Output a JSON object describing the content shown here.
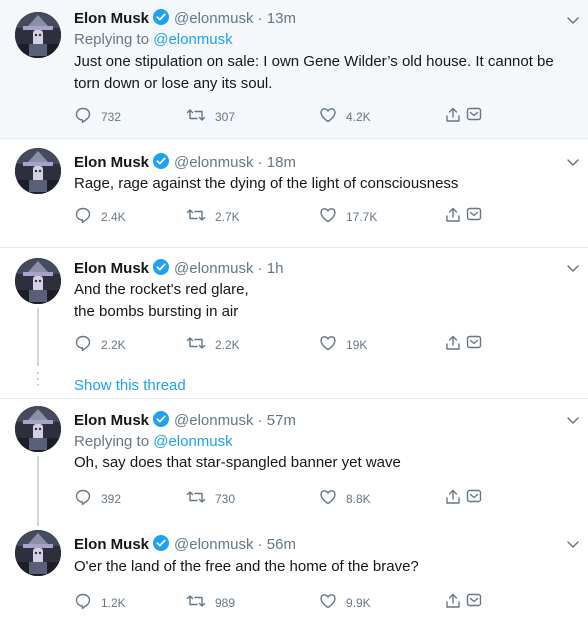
{
  "tweets": [
    {
      "name": "Elon Musk",
      "handle": "@elonmusk",
      "dot": "·",
      "time": "13m",
      "reply_prefix": "Replying to",
      "reply_to": "@elonmusk",
      "lines": [
        "Just one stipulation on sale: I own Gene Wilder’s old house. It cannot be",
        "torn down or lose any its soul."
      ],
      "replies": "732",
      "retweets": "307",
      "likes": "4.2K"
    },
    {
      "name": "Elon Musk",
      "handle": "@elonmusk",
      "dot": "·",
      "time": "18m",
      "lines": [
        "Rage, rage against the dying of the light of consciousness"
      ],
      "replies": "2.4K",
      "retweets": "2.7K",
      "likes": "17.7K"
    },
    {
      "name": "Elon Musk",
      "handle": "@elonmusk",
      "dot": "·",
      "time": "1h",
      "lines": [
        "And the rocket's red glare,",
        "the bombs bursting in air"
      ],
      "replies": "2.2K",
      "retweets": "2.2K",
      "likes": "19K"
    },
    {
      "name": "Elon Musk",
      "handle": "@elonmusk",
      "dot": "·",
      "time": "57m",
      "reply_prefix": "Replying to",
      "reply_to": "@elonmusk",
      "lines": [
        "Oh, say does that star-spangled banner yet wave"
      ],
      "replies": "392",
      "retweets": "730",
      "likes": "8.8K"
    },
    {
      "name": "Elon Musk",
      "handle": "@elonmusk",
      "dot": "·",
      "time": "56m",
      "lines": [
        "O'er the land of the free and the home of the brave?"
      ],
      "replies": "1.2K",
      "retweets": "989",
      "likes": "9.9K"
    }
  ],
  "show_thread": "Show this thread",
  "icons": {
    "reply": "reply-icon",
    "retweet": "retweet-icon",
    "like": "heart-icon",
    "share": "share-icon",
    "dm": "dm-icon",
    "more": "chevron-down-icon",
    "verified": "verified-badge-icon"
  },
  "colors": {
    "accent": "#1da1f2",
    "muted": "#657786",
    "text": "#14171a",
    "highlight_bg": "#f5f8fa",
    "divider": "#e6ecf0"
  }
}
